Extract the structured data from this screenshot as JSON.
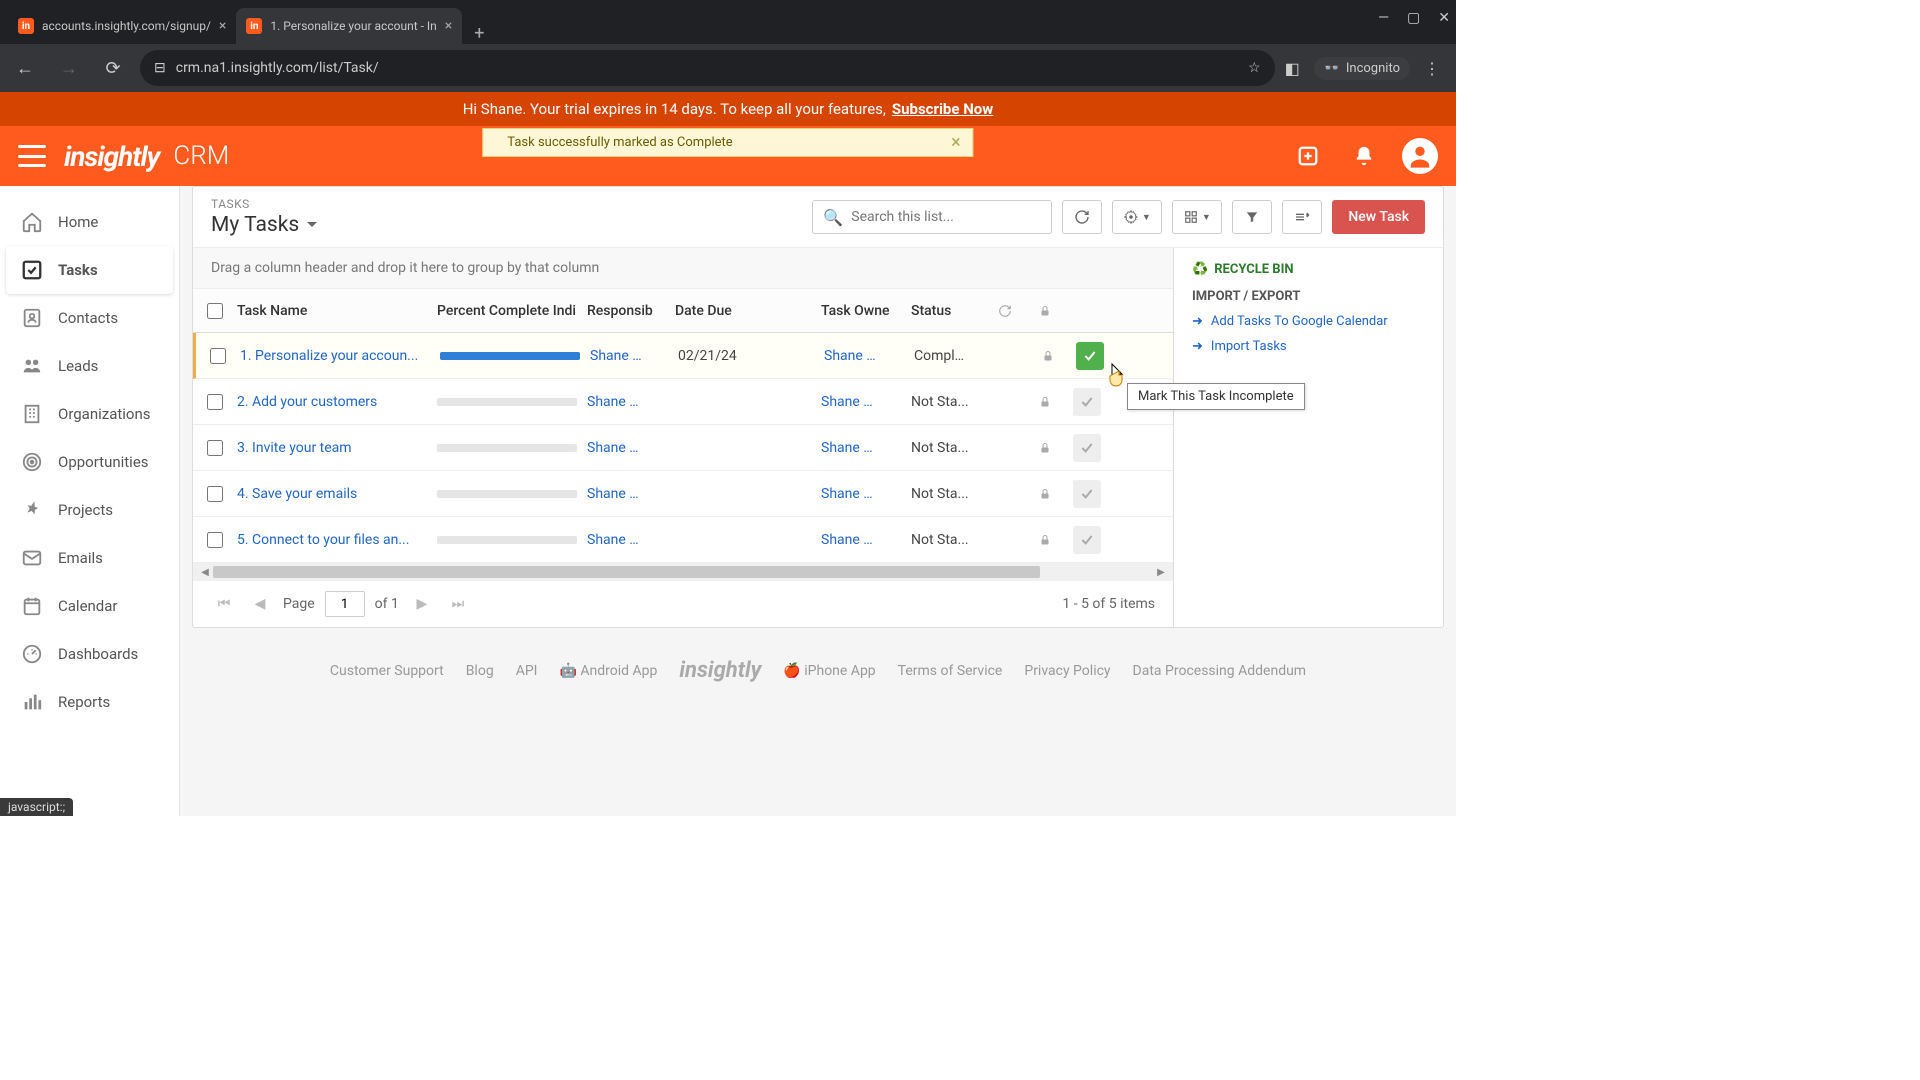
{
  "browser": {
    "tabs": [
      {
        "title": "accounts.insightly.com/signup/"
      },
      {
        "title": "1. Personalize your account - In"
      }
    ],
    "url": "crm.na1.insightly.com/list/Task/",
    "incognito_label": "Incognito"
  },
  "trial": {
    "text_prefix": "Hi Shane. Your trial expires in 14 days. To keep all your features, ",
    "cta": "Subscribe Now"
  },
  "header": {
    "logo": "insightly",
    "app": "CRM",
    "toast": "Task successfully marked as Complete"
  },
  "sidebar": {
    "items": [
      {
        "label": "Home"
      },
      {
        "label": "Tasks"
      },
      {
        "label": "Contacts"
      },
      {
        "label": "Leads"
      },
      {
        "label": "Organizations"
      },
      {
        "label": "Opportunities"
      },
      {
        "label": "Projects"
      },
      {
        "label": "Emails"
      },
      {
        "label": "Calendar"
      },
      {
        "label": "Dashboards"
      },
      {
        "label": "Reports"
      }
    ]
  },
  "list": {
    "breadcrumb": "TASKS",
    "title": "My Tasks",
    "search_placeholder": "Search this list...",
    "new_button": "New Task",
    "group_hint": "Drag a column header and drop it here to group by that column",
    "columns": {
      "name": "Task Name",
      "pct": "Percent Complete Indi",
      "resp": "Responsib",
      "due": "Date Due",
      "owner": "Task Owne",
      "status": "Status"
    },
    "rows": [
      {
        "name": "1. Personalize your accoun...",
        "pct": 100,
        "resp": "Shane …",
        "due": "02/21/24",
        "owner": "Shane …",
        "status": "Compl…",
        "complete": true
      },
      {
        "name": "2. Add your customers",
        "pct": 0,
        "resp": "Shane …",
        "due": "",
        "owner": "Shane …",
        "status": "Not Sta...",
        "complete": false
      },
      {
        "name": "3. Invite your team",
        "pct": 0,
        "resp": "Shane …",
        "due": "",
        "owner": "Shane …",
        "status": "Not Sta...",
        "complete": false
      },
      {
        "name": "4. Save your emails",
        "pct": 0,
        "resp": "Shane …",
        "due": "",
        "owner": "Shane …",
        "status": "Not Sta...",
        "complete": false
      },
      {
        "name": "5. Connect to your files an...",
        "pct": 0,
        "resp": "Shane …",
        "due": "",
        "owner": "Shane …",
        "status": "Not Sta...",
        "complete": false
      }
    ],
    "tooltip": "Mark This Task Incomplete",
    "pager": {
      "page_label": "Page",
      "page": "1",
      "of_label": "of 1",
      "summary": "1 - 5 of 5 items"
    }
  },
  "side": {
    "recycle": "RECYCLE BIN",
    "section": "IMPORT / EXPORT",
    "links": [
      "Add Tasks To Google Calendar",
      "Import Tasks"
    ]
  },
  "footer": {
    "links": [
      "Customer Support",
      "Blog",
      "API",
      "Android App",
      "",
      "iPhone App",
      "Terms of Service",
      "Privacy Policy",
      "Data Processing Addendum"
    ],
    "logo": "insightly"
  },
  "status_bar": "javascript:;"
}
